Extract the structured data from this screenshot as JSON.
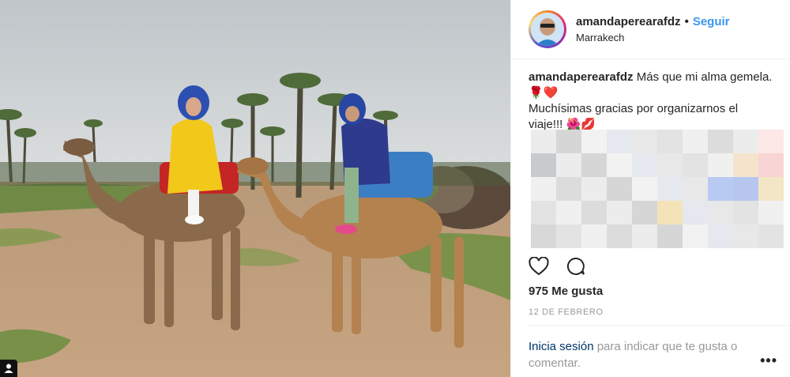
{
  "post": {
    "username": "amandaperearafdz",
    "follow_label": "Seguir",
    "location": "Marrakech",
    "caption_user": "amandaperearafdz",
    "caption_text": "Más que mi alma gemela.",
    "caption_emoji_1": "🌹❤️",
    "caption_text_2": "Muchísimas gracias por organizarnos el viaje!!!",
    "caption_emoji_2": "🌺💋",
    "likes": "975 Me gusta",
    "date": "12 DE FEBRERO",
    "login_link": "Inicia sesión",
    "login_text": " para indicar que te gusta o comentar.",
    "more_label": "•••"
  },
  "icons": {
    "like": "heart-icon",
    "comment": "comment-icon",
    "user_tag": "user-tag-icon"
  },
  "colors": {
    "follow": "#3897f0",
    "link": "#003569",
    "muted": "#999999"
  }
}
